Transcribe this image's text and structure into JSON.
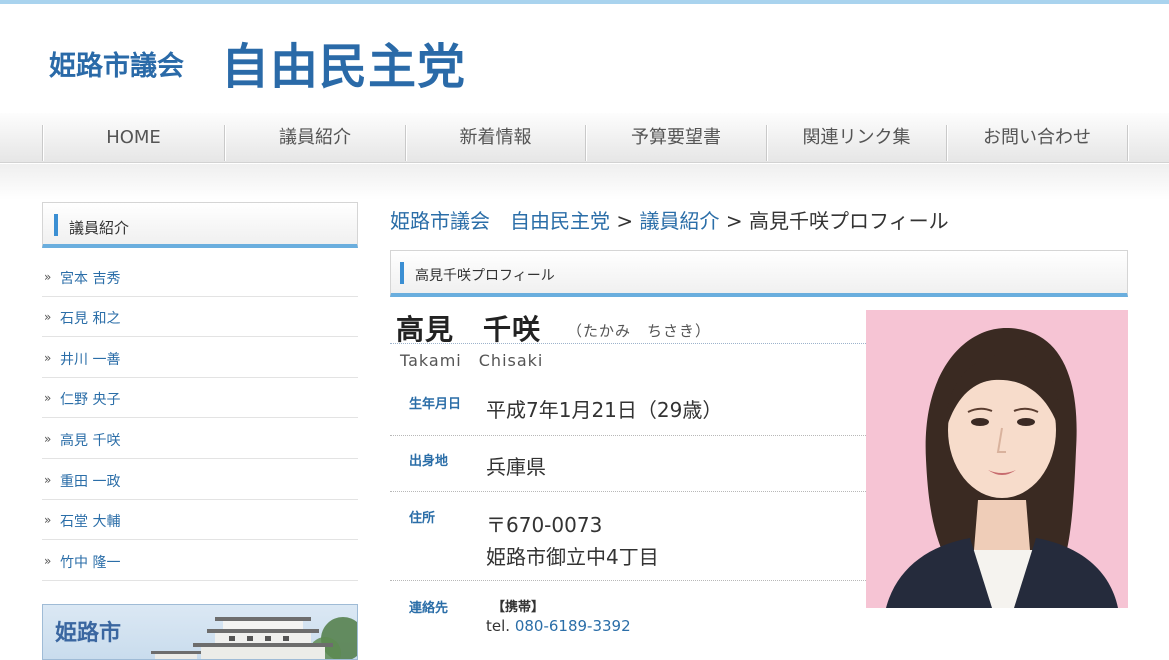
{
  "header": {
    "logo_small": "姫路市議会",
    "logo_big": "自由民主党"
  },
  "nav": {
    "items": [
      {
        "label": "HOME"
      },
      {
        "label": "議員紹介"
      },
      {
        "label": "新着情報"
      },
      {
        "label": "予算要望書"
      },
      {
        "label": "関連リンク集"
      },
      {
        "label": "お問い合わせ"
      }
    ]
  },
  "sidebar": {
    "title": "議員紹介",
    "bullet": "»",
    "members": [
      {
        "name": "宮本 吉秀"
      },
      {
        "name": "石見 和之"
      },
      {
        "name": "井川 一善"
      },
      {
        "name": "仁野 央子"
      },
      {
        "name": "高見 千咲"
      },
      {
        "name": "重田 一政"
      },
      {
        "name": "石堂 大輔"
      },
      {
        "name": "竹中 隆一"
      }
    ],
    "banner_text": "姫路市"
  },
  "breadcrumb": {
    "home": "姫路市議会　自由民主党",
    "sep1": " > ",
    "section": "議員紹介",
    "sep2": " > ",
    "current": "高見千咲プロフィール"
  },
  "profile": {
    "section_title": "高見千咲プロフィール",
    "name": "高見　千咲",
    "kana": "（たかみ　ちさき）",
    "roman": "Takami　Chisaki",
    "birthday_label": "生年月日",
    "birthday_value": "平成7年1月21日（29歳）",
    "birthplace_label": "出身地",
    "birthplace_value": "兵庫県",
    "address_label": "住所",
    "postal": "〒670-0073",
    "address": "姫路市御立中4丁目",
    "contact_label": "連絡先",
    "contact_type": "【携帯】",
    "tel_prefix": "tel. ",
    "tel_number": "080-6189-3392"
  },
  "colors": {
    "accent": "#2b6ea8",
    "accent_bar": "#6aaede",
    "photo_bg": "#f6c4d4"
  }
}
